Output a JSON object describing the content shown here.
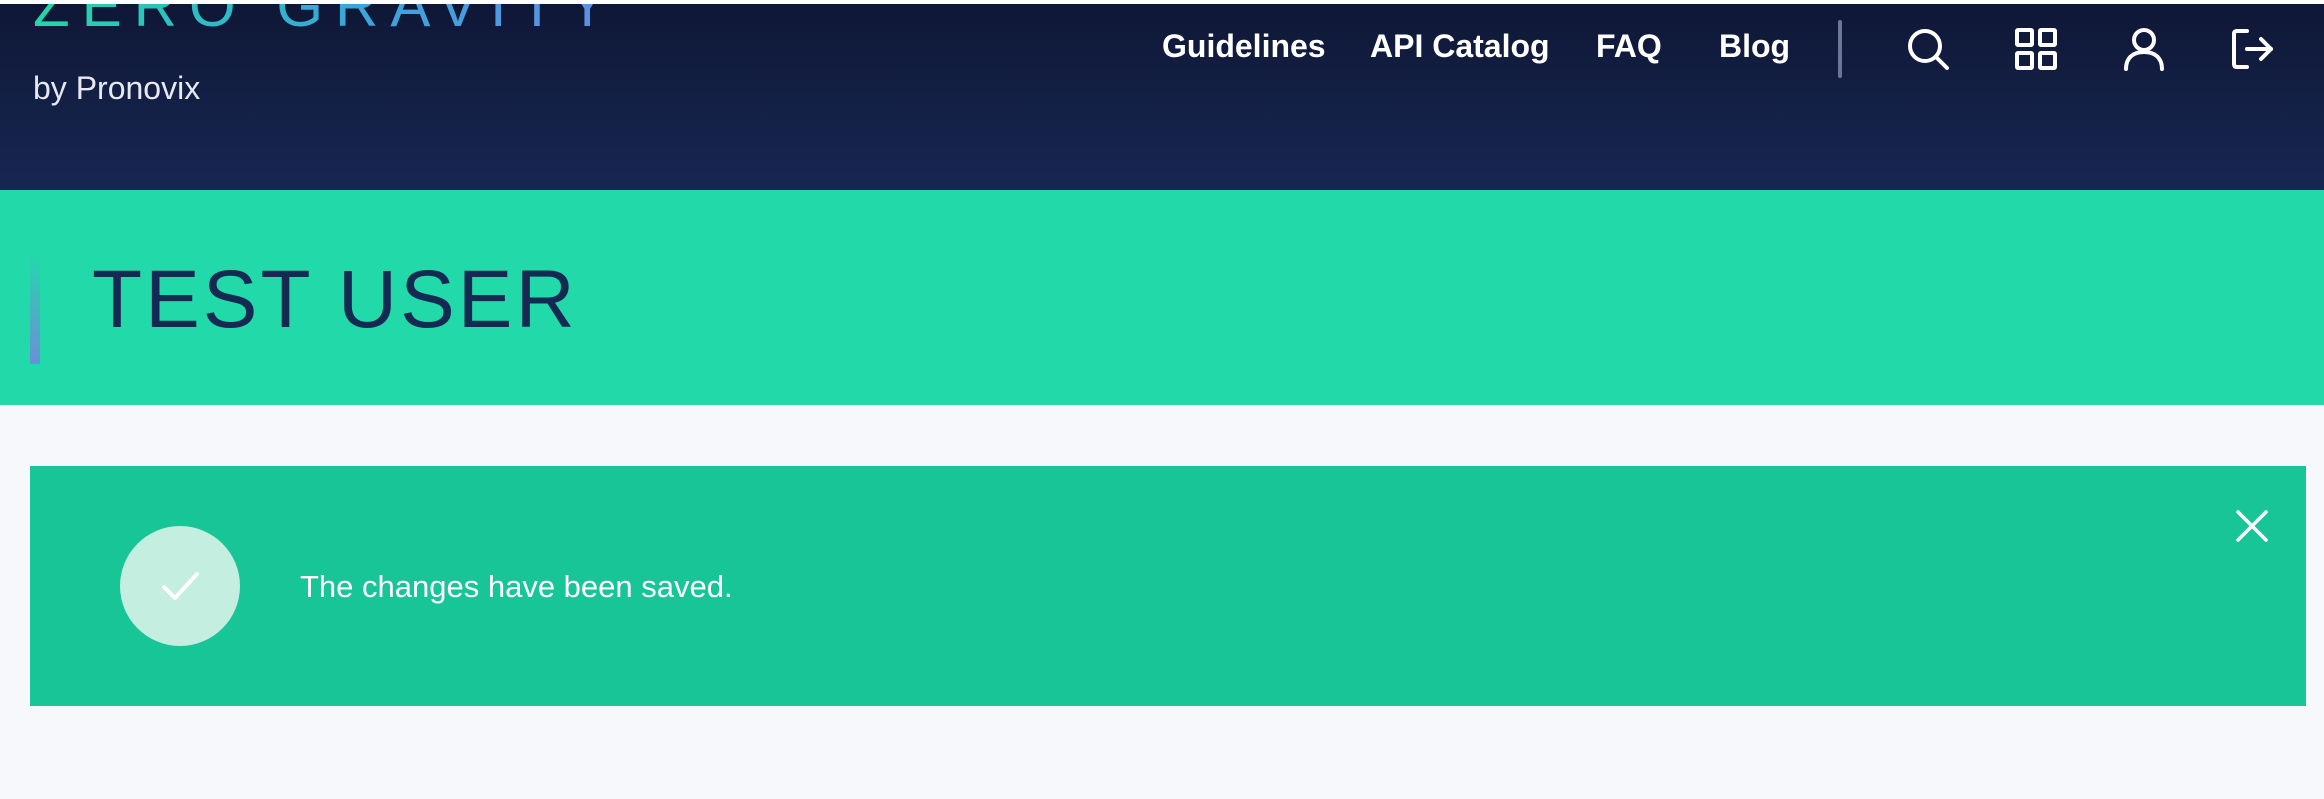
{
  "header": {
    "logo_text": "ZERO GRAVITY",
    "byline": "by Pronovix",
    "nav_links": [
      {
        "label": "Guidelines"
      },
      {
        "label": "API Catalog"
      },
      {
        "label": "FAQ"
      },
      {
        "label": "Blog"
      }
    ],
    "icons": [
      "search-icon",
      "apps-grid-icon",
      "user-icon",
      "logout-icon"
    ]
  },
  "page": {
    "title": "TEST USER"
  },
  "alert": {
    "message": "The changes have been saved.",
    "icon": "checkmark-icon",
    "close_icon": "close-icon"
  },
  "colors": {
    "header_bg_top": "#0f1736",
    "header_bg_bottom": "#172752",
    "title_band": "#22d9aa",
    "title_text": "#152a52",
    "alert_bg": "#17c597",
    "page_bg": "#f7f8fc"
  }
}
